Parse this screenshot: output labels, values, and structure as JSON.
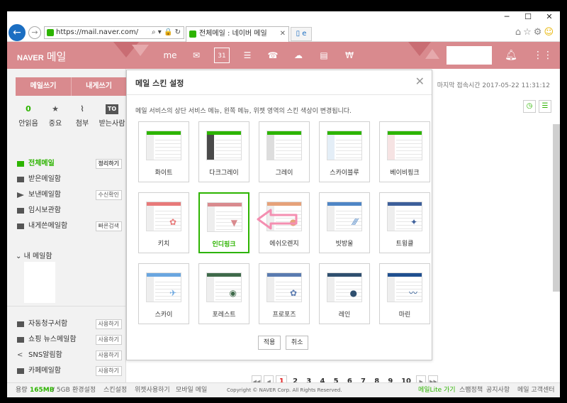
{
  "browser": {
    "url": "https://mail.naver.com/",
    "tab_title": "전체메일 : 네이버 메일",
    "url_tools": "⌕ ▾ 🔒 ↻",
    "window_controls": [
      "─",
      "☐",
      "✕"
    ]
  },
  "header": {
    "logo": "NAVER",
    "service": "메일",
    "calendar_day": "31",
    "brand_color": "#d98a8e"
  },
  "sidebar": {
    "compose": "메일쓰기",
    "send_self": "내게쓰기",
    "quick": [
      {
        "value": "0",
        "label": "안읽음"
      },
      {
        "value": "★",
        "label": "중요"
      },
      {
        "value": "⌇",
        "label": "첨부"
      },
      {
        "value": "TO",
        "label": "받는사람"
      }
    ],
    "folders": [
      {
        "label": "전체메일",
        "tag": "정리하기"
      },
      {
        "label": "받은메일함",
        "tag": ""
      },
      {
        "label": "보낸메일함",
        "tag": "수신확인"
      },
      {
        "label": "임시보관함",
        "tag": ""
      },
      {
        "label": "내게쓴메일함",
        "tag": "빠른검색"
      }
    ],
    "my_folders": "내 메일함",
    "bottom_folders": [
      {
        "label": "자동청구서함",
        "tag": "사용하기"
      },
      {
        "label": "쇼핑 뉴스메일함",
        "tag": "사용하기"
      },
      {
        "label": "SNS알림함",
        "tag": "사용하기"
      },
      {
        "label": "카페메일함",
        "tag": "사용하기"
      }
    ]
  },
  "main": {
    "last_login": "마지막 접속시간 2017-05-22 11:31:12",
    "pages": [
      "1",
      "2",
      "3",
      "4",
      "5",
      "6",
      "7",
      "8",
      "9",
      "10"
    ],
    "current_page": "1"
  },
  "dialog": {
    "title": "메일 스킨 설정",
    "description": "메일 서비스의 상단 서비스 메뉴, 왼쪽 메뉴, 위젯 영역의 스킨 색상이 변경됩니다.",
    "skins": [
      {
        "label": "화이트",
        "bar": "#2db400",
        "side": "#eeeeee",
        "deco": ""
      },
      {
        "label": "다크그레이",
        "bar": "#2db400",
        "side": "#4a4a4a",
        "deco": ""
      },
      {
        "label": "그레이",
        "bar": "#2db400",
        "side": "#dddddd",
        "deco": ""
      },
      {
        "label": "스카이블루",
        "bar": "#2db400",
        "side": "#e4eef7",
        "deco": ""
      },
      {
        "label": "베이비핑크",
        "bar": "#2db400",
        "side": "#f6e3e3",
        "deco": ""
      },
      {
        "label": "키치",
        "bar": "#e87a7a",
        "side": "#eeeeee",
        "deco": "✿"
      },
      {
        "label": "인디핑크",
        "bar": "#d98a8e",
        "side": "#eeeeee",
        "deco": "▼"
      },
      {
        "label": "에쉬오렌지",
        "bar": "#e6a27a",
        "side": "#eeeeee",
        "deco": "●"
      },
      {
        "label": "빗방울",
        "bar": "#4f86c6",
        "side": "#eeeeee",
        "deco": "⁄⁄⁄"
      },
      {
        "label": "트윙클",
        "bar": "#3d5f9a",
        "side": "#eeeeee",
        "deco": "✦"
      },
      {
        "label": "스카이",
        "bar": "#6aa6e0",
        "side": "#eeeeee",
        "deco": "✈"
      },
      {
        "label": "포레스트",
        "bar": "#3f6a4a",
        "side": "#eeeeee",
        "deco": "◉"
      },
      {
        "label": "프로포즈",
        "bar": "#5a7bb0",
        "side": "#eeeeee",
        "deco": "✿"
      },
      {
        "label": "레인",
        "bar": "#2f4f6f",
        "side": "#eeeeee",
        "deco": "●"
      },
      {
        "label": "마린",
        "bar": "#1f4f8f",
        "side": "#eeeeee",
        "deco": "〰"
      }
    ],
    "selected_skin": "인디핑크",
    "apply": "적용",
    "cancel": "취소"
  },
  "footer": {
    "capacity_label": "용량",
    "used": "165MB",
    "total": "/ 5GB",
    "links": [
      "환경설정",
      "스킨설정",
      "위젯사용하기",
      "모바일 메일"
    ],
    "copyright": "Copyright © NAVER Corp. All Rights Reserved.",
    "right_links": [
      "메일Lite 가기",
      "스팸정책",
      "공지사항",
      "메일 고객센터"
    ]
  }
}
